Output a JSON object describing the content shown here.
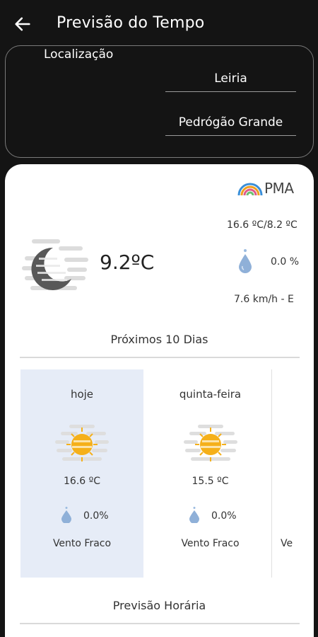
{
  "header": {
    "title": "Previsão do Tempo",
    "back_icon": "arrow-left-icon"
  },
  "location": {
    "label": "Localização",
    "district": "Leiria",
    "municipality": "Pedrógão Grande"
  },
  "provider": {
    "name": "PMA",
    "logo_icon": "ipma-rainbow-logo"
  },
  "current": {
    "icon": "night-partly-cloudy-moon-icon",
    "temperature": "9.2ºC",
    "min_max": "16.6 ºC/8.2 ºC",
    "precip_icon": "rain-drop-icon",
    "precipitation": "0.0 %",
    "wind": "7.6 km/h - E"
  },
  "forecast_10_days": {
    "title": "Próximos 10 Dias",
    "days": [
      {
        "name": "hoje",
        "icon": "sun-behind-clouds-icon",
        "temperature": "16.6 ºC",
        "precipitation": "0.0%",
        "wind": "Vento Fraco",
        "selected": true
      },
      {
        "name": "quinta-feira",
        "icon": "sun-behind-clouds-icon",
        "temperature": "15.5 ºC",
        "precipitation": "0.0%",
        "wind": "Vento Fraco",
        "selected": false
      },
      {
        "name": "",
        "icon": "",
        "temperature": "",
        "precipitation": "",
        "wind": "Ve",
        "selected": false
      }
    ]
  },
  "hourly": {
    "title": "Previsão Horária"
  },
  "colors": {
    "background": "#141414",
    "sheet": "#ffffff",
    "selected_day": "#e6ecf7",
    "sun": "#f5b01a",
    "drop": "#7aa6d6"
  }
}
